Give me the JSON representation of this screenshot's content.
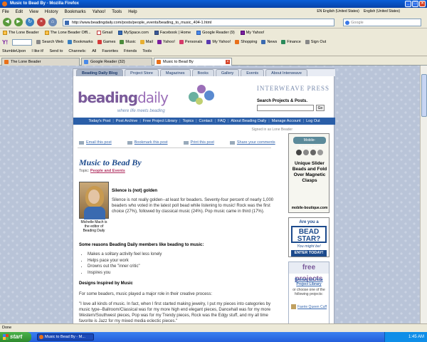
{
  "window": {
    "title": "Music to Bead By - Mozilla Firefox"
  },
  "menu": [
    "File",
    "Edit",
    "View",
    "History",
    "Bookmarks",
    "Yahoo!",
    "Tools",
    "Help"
  ],
  "languages": [
    "EN English (United States)",
    "English (United States)"
  ],
  "nav": {
    "url": "http://www.beadingdaily.com/posts/people_events/beading_to_music_404-1.html",
    "search_placeholder": "Google"
  },
  "bookmarks": [
    "The Lone Beader",
    "The Lone Beader Offl...",
    "Gmail",
    "MySpace.com",
    "Facebook | Home",
    "Google Reader (9)",
    "My Yahoo!"
  ],
  "toolbar2": [
    "Search Web",
    "Bookmarks",
    "Games",
    "Music",
    "Mail",
    "Yahoo!",
    "Personals",
    "My Yahoo!",
    "Shopping",
    "News",
    "Finance",
    "Sign Out"
  ],
  "toolbar3": [
    "StumbleUpon",
    "I like it!",
    "Send to",
    "Channels:",
    "All",
    "Favorites",
    "Friends",
    "Tools"
  ],
  "tabs": [
    {
      "label": "The Lone Beader"
    },
    {
      "label": "Google Reader (32)"
    },
    {
      "label": "Music to Bead By"
    }
  ],
  "site": {
    "tabs": [
      "Beading Daily Blog",
      "Project Store",
      "Magazines",
      "Books",
      "Gallery",
      "Events",
      "About Interweave"
    ],
    "logo_main": "beading",
    "logo_sub": "daily",
    "tagline": "where life meets beading",
    "publisher": "INTERWEAVE PRESS",
    "search_label": "Search Projects & Posts.",
    "go_label": "Go",
    "nav": [
      "Today's Post",
      "Post Archive",
      "Free Project Library",
      "Topics",
      "Contact",
      "FAQ",
      "About Beading Daily",
      "Manage Account",
      "Log Out"
    ],
    "signed_in": "Signed in as Lone Beader"
  },
  "article": {
    "actions": [
      "Email this post",
      "Bookmark this post",
      "Print this post",
      "Share your comments"
    ],
    "title": "Music to Bead By",
    "topic_label": "Topic:",
    "topic": "People and Events",
    "photo_caption": "Michelle Mach is the editor of Beading Daily",
    "h1": "Silence is (not) golden",
    "p1": "Silence is not really golden--at least for beaders. Seventy-four percent of nearly 1,000 beaders who voted in the latest poll bead while listening to music! Rock was the first choice (27%), followed by classical music (24%). Pop music came in third (17%).",
    "h2": "Some reasons Beading Daily members like beading to music:",
    "reasons": [
      "Makes a solitary activity feel less lonely",
      "Helps pace your work",
      "Drowns out the \"inner critic\"",
      "Inspires you"
    ],
    "h3": "Designs Inspired by Music",
    "p2": "For some beaders, music played a major role in their creative process:",
    "p3": "\"I love all kinds of music. In fact, when I first started making jewelry, I put my pieces into categories by music type--Ballroom/Classical was for my more high end elegant pieces, Dancehall was for my more Western/Southwest pieces, Pop was for my Trendy pieces, Rock was the Edgy stuff, and my all time favorite is Jazz for my mixed media eclectic pieces.\""
  },
  "ads": {
    "ad1_brand": "Mobile-Boutique.com",
    "ad1_text": "Unique Slider Beads and Fold Over Magnetic Clasps",
    "ad1_url": "mobile-boutique.com",
    "ad2_l1": "Are you a",
    "ad2_l2": "BEAD STAR?",
    "ad2_l3": "You might be!",
    "ad2_l4": "ENTER TODAY!",
    "free_title": "free projects",
    "free_link": "Browse our Free Project Library",
    "free_text": "or choose one of the following projects:",
    "free_item": "Faerie Queen Cuff"
  },
  "status": "Done",
  "taskbar": {
    "start": "start",
    "item": "Music to Bead By - M...",
    "time": "1:45 AM"
  }
}
